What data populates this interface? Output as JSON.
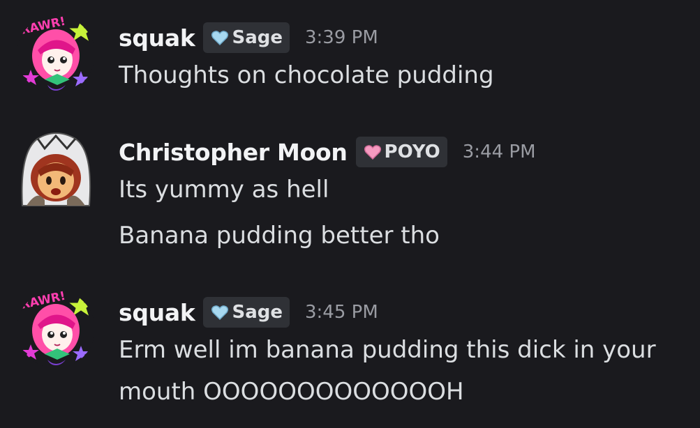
{
  "messages": [
    {
      "username": "squak",
      "tag": {
        "label": "Sage",
        "icon": "blue-heart-icon",
        "color": "#a7d8f0"
      },
      "time": "3:39 PM",
      "lines": [
        "Thoughts on chocolate pudding"
      ]
    },
    {
      "username": "Christopher Moon",
      "tag": {
        "label": "POYO",
        "icon": "pink-heart-icon",
        "color": "#f59ac0"
      },
      "time": "3:44 PM",
      "lines": [
        "Its yummy as hell",
        "Banana pudding better tho"
      ]
    },
    {
      "username": "squak",
      "tag": {
        "label": "Sage",
        "icon": "blue-heart-icon",
        "color": "#a7d8f0"
      },
      "time": "3:45 PM",
      "lines": [
        "Erm well im banana pudding this dick in your",
        "mouth OOOOOOOOOOOOOH"
      ]
    }
  ],
  "avatars": {
    "squak": {
      "logo_text": "RAWR!",
      "icon": "anime-girl-avatar"
    },
    "christopher": {
      "icon": "masked-boy-avatar"
    }
  }
}
